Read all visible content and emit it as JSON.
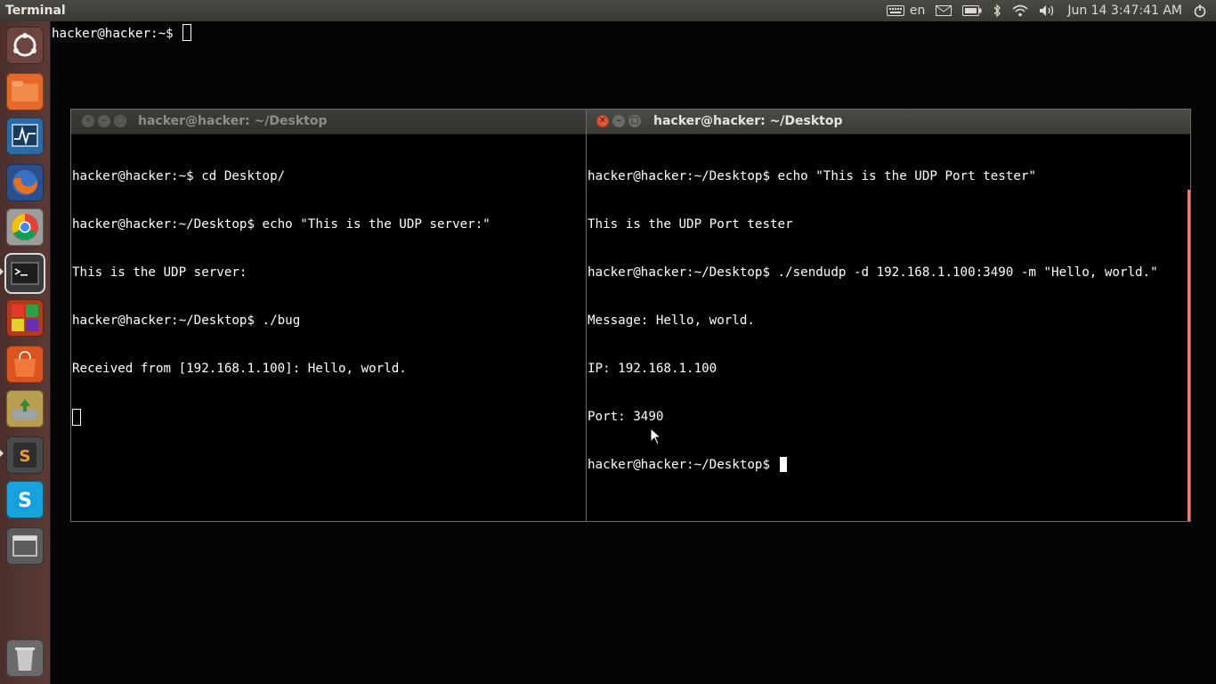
{
  "panel": {
    "app_title": "Terminal",
    "keyboard_layout": "en",
    "clock": "Jun 14  3:47:41 AM",
    "icons": [
      "keyboard-icon",
      "mail-icon",
      "battery-icon",
      "bluetooth-icon",
      "wifi-icon",
      "volume-icon",
      "power-gear-icon"
    ]
  },
  "launcher": {
    "items": [
      {
        "name": "dash-home",
        "color": "#7b4a44"
      },
      {
        "name": "files",
        "color": "#e8632a"
      },
      {
        "name": "system-monitor",
        "color": "#2f6fa7"
      },
      {
        "name": "firefox",
        "color": "#d9541e"
      },
      {
        "name": "chrome",
        "color": "#cfcfcf"
      },
      {
        "name": "terminal",
        "color": "#3a3a3a"
      },
      {
        "name": "crossover",
        "color": "#c43a1c"
      },
      {
        "name": "ubuntu-software",
        "color": "#d9541e"
      },
      {
        "name": "backup",
        "color": "#c9b04e"
      },
      {
        "name": "sublime-text",
        "color": "#4d4d4d"
      },
      {
        "name": "skype",
        "color": "#1aa3dc"
      },
      {
        "name": "workspace-switcher",
        "color": "#5a5a5a"
      },
      {
        "name": "trash",
        "color": "#6b6b6b"
      }
    ]
  },
  "desktop_terminal": {
    "prompt": "hacker@hacker:~$ "
  },
  "window_left": {
    "title": "hacker@hacker: ~/Desktop",
    "lines": [
      "hacker@hacker:~$ cd Desktop/",
      "hacker@hacker:~/Desktop$ echo \"This is the UDP server:\"",
      "This is the UDP server:",
      "hacker@hacker:~/Desktop$ ./bug",
      "Received from [192.168.1.100]: Hello, world."
    ]
  },
  "window_right": {
    "title": "hacker@hacker: ~/Desktop",
    "lines": [
      "hacker@hacker:~/Desktop$ echo \"This is the UDP Port tester\"",
      "This is the UDP Port tester",
      "hacker@hacker:~/Desktop$ ./sendudp -d 192.168.1.100:3490 -m \"Hello, world.\"",
      "Message: Hello, world.",
      "IP: 192.168.1.100",
      "Port: 3490"
    ],
    "prompt": "hacker@hacker:~/Desktop$ "
  },
  "colors": {
    "close_active": "#e0583a",
    "accent_scroll": "#e0836a",
    "terminal_bg": "#000000",
    "terminal_fg": "#ffffff"
  }
}
